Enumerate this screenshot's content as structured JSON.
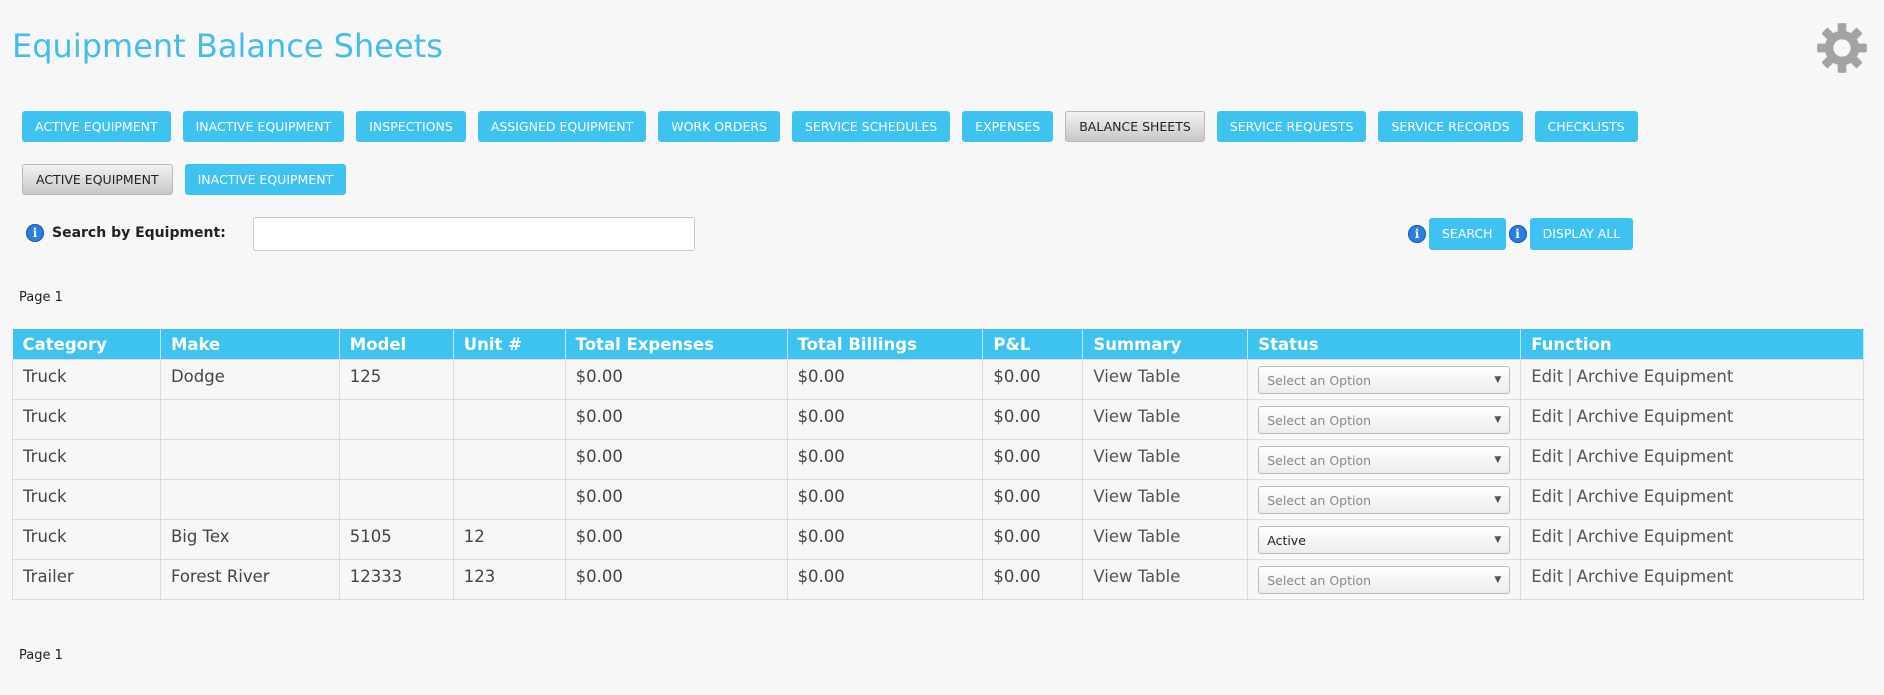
{
  "header": {
    "title": "Equipment Balance Sheets",
    "settings_icon": "gear-icon"
  },
  "nav": {
    "primary": [
      {
        "label": "ACTIVE EQUIPMENT",
        "active": false
      },
      {
        "label": "INACTIVE EQUIPMENT",
        "active": false
      },
      {
        "label": "INSPECTIONS",
        "active": false
      },
      {
        "label": "ASSIGNED EQUIPMENT",
        "active": false
      },
      {
        "label": "WORK ORDERS",
        "active": false
      },
      {
        "label": "SERVICE SCHEDULES",
        "active": false
      },
      {
        "label": "EXPENSES",
        "active": false
      },
      {
        "label": "BALANCE SHEETS",
        "active": true
      },
      {
        "label": "SERVICE REQUESTS",
        "active": false
      },
      {
        "label": "SERVICE RECORDS",
        "active": false
      },
      {
        "label": "CHECKLISTS",
        "active": false
      }
    ],
    "secondary": [
      {
        "label": "ACTIVE EQUIPMENT",
        "active": true
      },
      {
        "label": "INACTIVE EQUIPMENT",
        "active": false
      }
    ]
  },
  "search": {
    "label": "Search by Equipment:",
    "value": "",
    "placeholder": "",
    "search_button": "SEARCH",
    "display_all_button": "DISPLAY ALL",
    "info_icon": "i"
  },
  "pagination": {
    "top": "Page 1",
    "bottom": "Page 1"
  },
  "table": {
    "columns": [
      "Category",
      "Make",
      "Model",
      "Unit #",
      "Total Expenses",
      "Total Billings",
      "P&L",
      "Summary",
      "Status",
      "Function"
    ],
    "rows": [
      {
        "category": "Truck",
        "make": "Dodge",
        "model": "125",
        "unit": "",
        "total_expenses": "$0.00",
        "total_billings": "$0.00",
        "pl": "$0.00",
        "summary": "View Table",
        "status": "Select an Option",
        "edit": "Edit",
        "archive": "Archive Equipment"
      },
      {
        "category": "Truck",
        "make": "",
        "model": "",
        "unit": "",
        "total_expenses": "$0.00",
        "total_billings": "$0.00",
        "pl": "$0.00",
        "summary": "View Table",
        "status": "Select an Option",
        "edit": "Edit",
        "archive": "Archive Equipment"
      },
      {
        "category": "Truck",
        "make": "",
        "model": "",
        "unit": "",
        "total_expenses": "$0.00",
        "total_billings": "$0.00",
        "pl": "$0.00",
        "summary": "View Table",
        "status": "Select an Option",
        "edit": "Edit",
        "archive": "Archive Equipment"
      },
      {
        "category": "Truck",
        "make": "",
        "model": "",
        "unit": "",
        "total_expenses": "$0.00",
        "total_billings": "$0.00",
        "pl": "$0.00",
        "summary": "View Table",
        "status": "Select an Option",
        "edit": "Edit",
        "archive": "Archive Equipment"
      },
      {
        "category": "Truck",
        "make": "Big Tex",
        "model": "5105",
        "unit": "12",
        "total_expenses": "$0.00",
        "total_billings": "$0.00",
        "pl": "$0.00",
        "summary": "View Table",
        "status": "Active",
        "edit": "Edit",
        "archive": "Archive Equipment"
      },
      {
        "category": "Trailer",
        "make": "Forest River",
        "model": "12333",
        "unit": "123",
        "total_expenses": "$0.00",
        "total_billings": "$0.00",
        "pl": "$0.00",
        "summary": "View Table",
        "status": "Select an Option",
        "edit": "Edit",
        "archive": "Archive Equipment"
      }
    ]
  },
  "colors": {
    "accent": "#3ec3f0",
    "title": "#43bde9",
    "active_button": "#c7c7c7",
    "info_icon": "#2a7de1"
  }
}
